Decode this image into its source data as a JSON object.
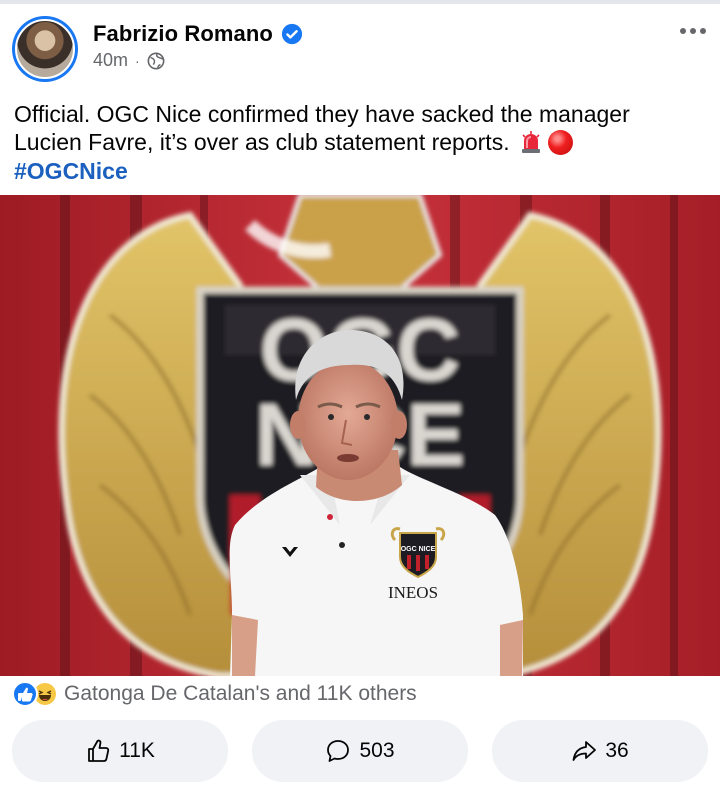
{
  "post": {
    "author": "Fabrizio Romano",
    "time": "40m",
    "separator": "·",
    "text_line1": "Official. OGC Nice confirmed they have sacked the manager",
    "text_line2": "Lucien Favre, it’s over as club statement reports.",
    "hashtag": "#OGCNice"
  },
  "photo": {
    "crest_text_1": "OGC",
    "crest_text_2": "NICE",
    "shirt_sponsor": "INEOS",
    "badge_text": "OGC NICE"
  },
  "reactions": {
    "summary": "Gatonga De Catalan's and 11K others"
  },
  "actions": {
    "like_count": "11K",
    "comment_count": "503",
    "share_count": "36"
  },
  "colors": {
    "brand_blue": "#1877f2",
    "hashtag": "#1b5fbf",
    "muted": "#65676b",
    "button_bg": "#f0f2f5"
  }
}
